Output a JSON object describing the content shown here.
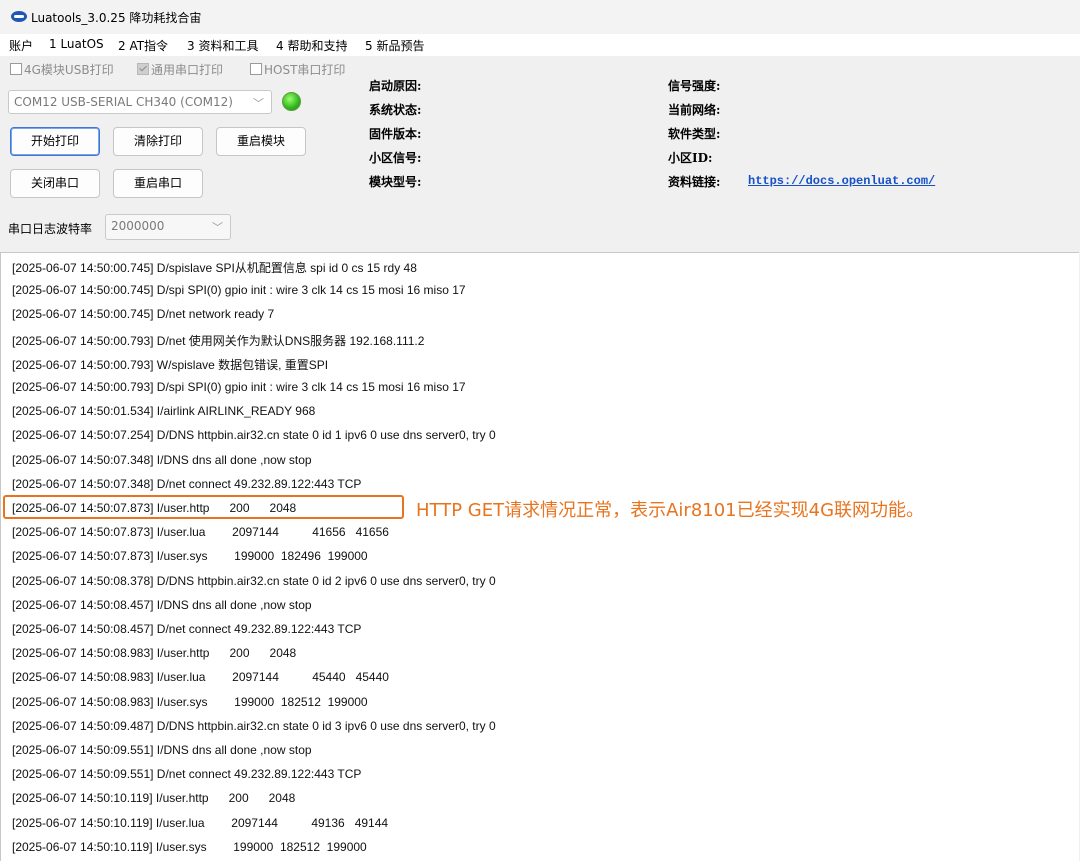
{
  "window": {
    "title": "Luatools_3.0.25 降功耗找合宙"
  },
  "menu": [
    "账户",
    "1 LuatOS",
    "2 AT指令",
    "3 资料和工具",
    "4 帮助和支持",
    "5 新品预告"
  ],
  "checkboxes": [
    {
      "label": "4G模块USB打印",
      "checked": false
    },
    {
      "label": "通用串口打印",
      "checked": true
    },
    {
      "label": "HOST串口打印",
      "checked": false
    }
  ],
  "port": {
    "selected": "COM12 USB-SERIAL CH340 (COM12)",
    "status_color": "#2fb51c"
  },
  "buttons": {
    "start_print": "开始打印",
    "clear_print": "清除打印",
    "restart_module": "重启模块",
    "close_port": "关闭串口",
    "restart_port": "重启串口"
  },
  "info": {
    "boot_reason": "启动原因:",
    "system_status": "系统状态:",
    "firmware_version": "固件版本:",
    "cell_signal": "小区信号:",
    "module_model": "模块型号:",
    "signal_strength": "信号强度:",
    "current_network": "当前网络:",
    "software_type": "软件类型:",
    "cell_id": "小区ID:",
    "docs_link_label": "资料链接:",
    "docs_link": "https://docs.openluat.com/"
  },
  "baud": {
    "label": "串口日志波特率",
    "value": "2000000"
  },
  "log_lines": [
    "[2025-06-07 14:50:00.745] D/spislave SPI从机配置信息 spi id 0 cs 15 rdy 48",
    "[2025-06-07 14:50:00.745] D/spi SPI(0) gpio init : wire 3 clk 14 cs 15 mosi 16 miso 17",
    "[2025-06-07 14:50:00.745] D/net network ready 7",
    "[2025-06-07 14:50:00.793] D/net 使用网关作为默认DNS服务器 192.168.111.2",
    "[2025-06-07 14:50:00.793] W/spislave 数据包错误, 重置SPI",
    "[2025-06-07 14:50:00.793] D/spi SPI(0) gpio init : wire 3 clk 14 cs 15 mosi 16 miso 17",
    "[2025-06-07 14:50:01.534] I/airlink AIRLINK_READY 968",
    "[2025-06-07 14:50:07.254] D/DNS httpbin.air32.cn state 0 id 1 ipv6 0 use dns server0, try 0",
    "[2025-06-07 14:50:07.348] I/DNS dns all done ,now stop",
    "[2025-06-07 14:50:07.348] D/net connect 49.232.89.122:443 TCP",
    "[2025-06-07 14:50:07.873] I/user.http      200      2048",
    "[2025-06-07 14:50:07.873] I/user.lua        2097144          41656   41656",
    "[2025-06-07 14:50:07.873] I/user.sys        199000  182496  199000",
    "[2025-06-07 14:50:08.378] D/DNS httpbin.air32.cn state 0 id 2 ipv6 0 use dns server0, try 0",
    "[2025-06-07 14:50:08.457] I/DNS dns all done ,now stop",
    "[2025-06-07 14:50:08.457] D/net connect 49.232.89.122:443 TCP",
    "[2025-06-07 14:50:08.983] I/user.http      200      2048",
    "[2025-06-07 14:50:08.983] I/user.lua        2097144          45440   45440",
    "[2025-06-07 14:50:08.983] I/user.sys        199000  182512  199000",
    "[2025-06-07 14:50:09.487] D/DNS httpbin.air32.cn state 0 id 3 ipv6 0 use dns server0, try 0",
    "[2025-06-07 14:50:09.551] I/DNS dns all done ,now stop",
    "[2025-06-07 14:50:09.551] D/net connect 49.232.89.122:443 TCP",
    "[2025-06-07 14:50:10.119] I/user.http      200      2048",
    "[2025-06-07 14:50:10.119] I/user.lua        2097144          49136   49144",
    "[2025-06-07 14:50:10.119] I/user.sys        199000  182512  199000"
  ],
  "annotation": {
    "text": "HTTP GET请求情况正常，表示Air8101已经实现4G联网功能。",
    "color": "#e8741f"
  }
}
